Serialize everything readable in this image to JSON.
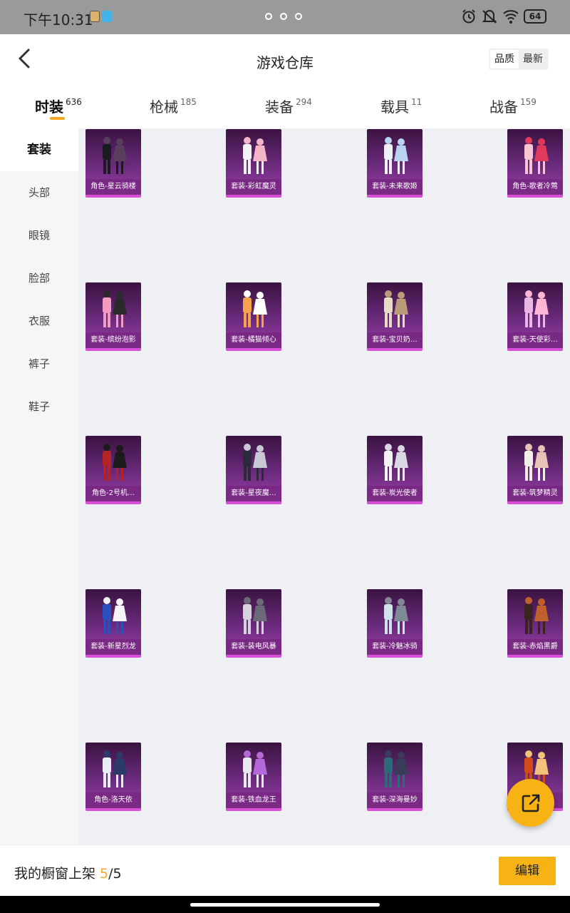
{
  "status_bar": {
    "time": "下午10:31",
    "battery": "64",
    "icons": [
      "alarm-icon",
      "mute-icon",
      "wifi-icon",
      "battery-icon"
    ]
  },
  "header": {
    "title": "游戏仓库",
    "sort_options": [
      "品质",
      "最新"
    ],
    "sort_active": "最新"
  },
  "tabs": [
    {
      "label": "时装",
      "count": "636"
    },
    {
      "label": "枪械",
      "count": "185"
    },
    {
      "label": "装备",
      "count": "294"
    },
    {
      "label": "载具",
      "count": "11"
    },
    {
      "label": "战备",
      "count": "159"
    }
  ],
  "sidebar": {
    "items": [
      "套装",
      "头部",
      "眼镜",
      "脸部",
      "衣服",
      "裤子",
      "鞋子"
    ]
  },
  "items": [
    "角色-星云骑楼",
    "套装-彩虹魔灵",
    "套装-未来歌姬",
    "角色-歌者冷莺",
    "套装-缤纷泡影",
    "套装-橘猫倾心",
    "套装-宝贝奶…",
    "套装-天使彩…",
    "角色-2号机…",
    "套装-星夜魔…",
    "套装-炭光使者",
    "套装-筑梦精灵",
    "套装-新星烈龙",
    "套装-装电风暴",
    "套装-冷魅冰骑",
    "套装-赤焰黑爵",
    "角色-洛天依",
    "套装-铁血龙王",
    "套装-深海曼妙",
    "套装-…"
  ],
  "bottom": {
    "showcase_prefix": "我的橱窗上架 ",
    "showcase_current": "5",
    "showcase_total": "/5",
    "edit_label": "编辑"
  },
  "colors": {
    "accent": "#f7b313",
    "card_gradient_top": "#3a1340",
    "card_gradient_bottom": "#9c3ea8",
    "card_border": "#d84fd8"
  }
}
